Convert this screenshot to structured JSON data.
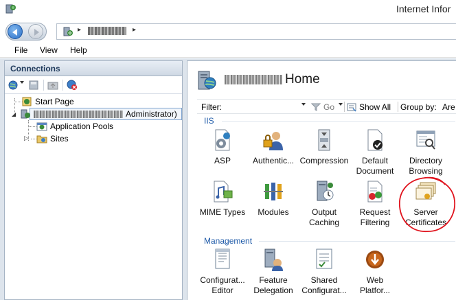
{
  "window": {
    "title": "Internet Infor"
  },
  "address_bar": {
    "separator": "▸"
  },
  "menu": {
    "items": [
      "File",
      "View",
      "Help"
    ]
  },
  "connections": {
    "header": "Connections",
    "tree": {
      "start_page": "Start Page",
      "server_suffix": "Administrator)",
      "application_pools": "Application Pools",
      "sites": "Sites"
    }
  },
  "main": {
    "title_suffix": "Home",
    "filter": {
      "label": "Filter:",
      "go": "Go",
      "show_all": "Show All",
      "group_by": "Group by:",
      "group_value": "Are"
    },
    "sections": [
      {
        "name": "IIS",
        "features": [
          {
            "label": "ASP",
            "icon": "asp-icon"
          },
          {
            "label": "Authentic...",
            "icon": "authentication-icon"
          },
          {
            "label": "Compression",
            "icon": "compression-icon"
          },
          {
            "label": "Default\nDocument",
            "icon": "default-document-icon"
          },
          {
            "label": "Directory\nBrowsing",
            "icon": "directory-browsing-icon"
          },
          {
            "label": "MIME Types",
            "icon": "mime-types-icon"
          },
          {
            "label": "Modules",
            "icon": "modules-icon"
          },
          {
            "label": "Output\nCaching",
            "icon": "output-caching-icon"
          },
          {
            "label": "Request\nFiltering",
            "icon": "request-filtering-icon"
          },
          {
            "label": "Server\nCertificates",
            "icon": "server-certificates-icon"
          }
        ]
      },
      {
        "name": "Management",
        "features": [
          {
            "label": "Configurat...\nEditor",
            "icon": "configuration-editor-icon"
          },
          {
            "label": "Feature\nDelegation",
            "icon": "feature-delegation-icon"
          },
          {
            "label": "Shared\nConfigurat...",
            "icon": "shared-configuration-icon"
          },
          {
            "label": "Web\nPlatfor...",
            "icon": "web-platform-icon"
          }
        ]
      }
    ]
  },
  "colors": {
    "section_label": "#1e5aa8",
    "annotation_circle": "#e0141e",
    "panel_border": "#a6b4c4"
  }
}
